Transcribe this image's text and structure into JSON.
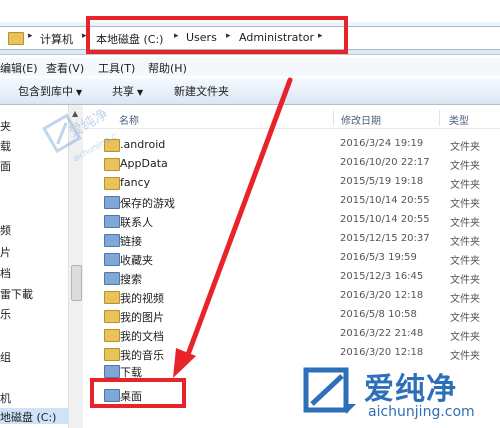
{
  "address": {
    "computer": "计算机",
    "drive": "本地磁盘 (C:)",
    "users": "Users",
    "admin": "Administrator"
  },
  "menu": [
    "编辑(E)",
    "查看(V)",
    "工具(T)",
    "帮助(H)"
  ],
  "toolbar": {
    "include": "包含到库中",
    "share": "共享",
    "new_folder": "新建文件夹"
  },
  "sidebar": [
    "夹",
    "载",
    "面",
    "频",
    "片",
    "档",
    "雷下載",
    "乐",
    "组",
    "机",
    "地磁盘 (C:)"
  ],
  "columns": {
    "name": "名称",
    "date": "修改日期",
    "type": "类型"
  },
  "files": [
    {
      "name": ".android",
      "date": "2016/3/24 19:19",
      "type": "文件夹"
    },
    {
      "name": "AppData",
      "date": "2016/10/20 22:17",
      "type": "文件夹"
    },
    {
      "name": "fancy",
      "date": "2015/5/19 19:18",
      "type": "文件夹"
    },
    {
      "name": "保存的游戏",
      "date": "2015/10/14 20:55",
      "type": "文件夹"
    },
    {
      "name": "联系人",
      "date": "2015/10/14 20:55",
      "type": "文件夹"
    },
    {
      "name": "链接",
      "date": "2015/12/15 20:37",
      "type": "文件夹"
    },
    {
      "name": "收藏夹",
      "date": "2016/5/3 19:59",
      "type": "文件夹"
    },
    {
      "name": "搜索",
      "date": "2015/12/3 16:45",
      "type": "文件夹"
    },
    {
      "name": "我的视频",
      "date": "2016/3/20 12:18",
      "type": "文件夹"
    },
    {
      "name": "我的图片",
      "date": "2016/5/8 10:58",
      "type": "文件夹"
    },
    {
      "name": "我的文档",
      "date": "2016/3/22 21:48",
      "type": "文件夹"
    },
    {
      "name": "我的音乐",
      "date": "2016/3/20 12:18",
      "type": "文件夹"
    },
    {
      "name": "下载",
      "date": "",
      "type": ""
    },
    {
      "name": "桌面",
      "date": "",
      "type": ""
    }
  ],
  "watermark": {
    "brand_cn": "爱纯净",
    "brand_url": "aichunjing.com"
  },
  "colors": {
    "highlight": "#e8242a",
    "brand": "#2d6fb8"
  }
}
